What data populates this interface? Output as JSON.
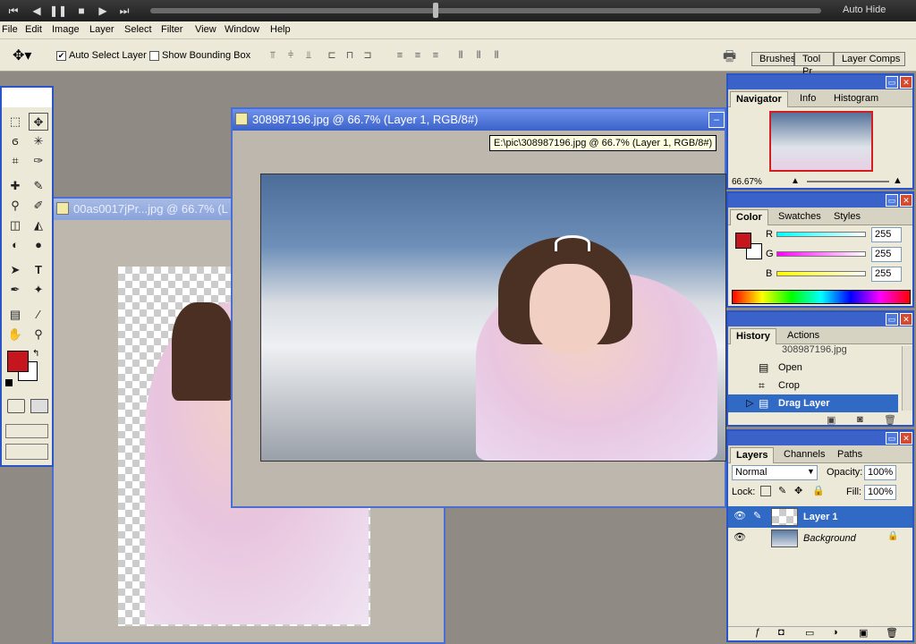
{
  "player": {
    "auto_hide": "Auto Hide"
  },
  "menu": [
    "File",
    "Edit",
    "Image",
    "Layer",
    "Select",
    "Filter",
    "View",
    "Window",
    "Help"
  ],
  "options": {
    "auto_select": "Auto Select Layer",
    "show_bounding": "Show Bounding Box",
    "wells": [
      "Brushes",
      "Tool Pr",
      "Layer Comps"
    ]
  },
  "docs": {
    "back_title": "00as0017jPr...jpg @ 66.7% (L",
    "front_title": "308987196.jpg @ 66.7% (Layer 1, RGB/8#)",
    "tooltip": "E:\\pic\\308987196.jpg @ 66.7% (Layer 1, RGB/8#)"
  },
  "navigator": {
    "tabs": [
      "Navigator",
      "Info",
      "Histogram"
    ],
    "zoom": "66.67%"
  },
  "color": {
    "tabs": [
      "Color",
      "Swatches",
      "Styles"
    ],
    "r_label": "R",
    "g_label": "G",
    "b_label": "B",
    "r": "255",
    "g": "255",
    "b": "255",
    "fg": "#c4161c"
  },
  "history": {
    "tabs": [
      "History",
      "Actions"
    ],
    "snapshot": "308987196.jpg",
    "items": [
      "Open",
      "Crop",
      "Drag Layer"
    ]
  },
  "layers": {
    "tabs": [
      "Layers",
      "Channels",
      "Paths"
    ],
    "blend": "Normal",
    "opacity_label": "Opacity:",
    "opacity": "100%",
    "lock_label": "Lock:",
    "fill_label": "Fill:",
    "fill": "100%",
    "items": [
      "Layer 1",
      "Background"
    ]
  }
}
